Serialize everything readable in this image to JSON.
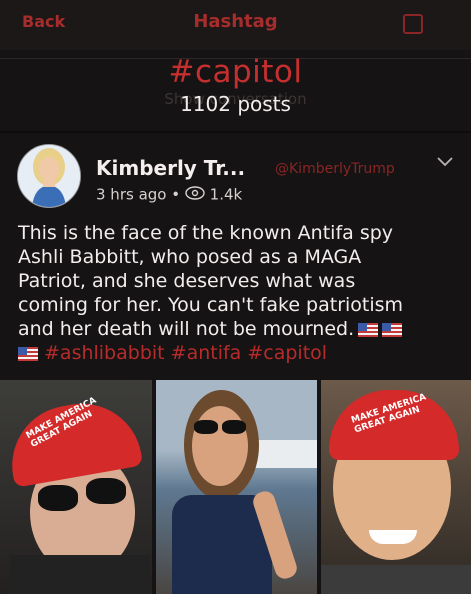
{
  "nav": {
    "back_label": "Back",
    "title": "Hashtag"
  },
  "header": {
    "hashtag": "#capitol",
    "faded_text": "Show conversation",
    "posts_count": "1102 posts"
  },
  "post": {
    "display_name": "Kimberly Tr...",
    "handle": "@KimberlyTrump",
    "time": "3 hrs ago",
    "dot": "•",
    "views": "1.4k",
    "lines": [
      "This is the face of the known Antifa spy",
      "Ashli Babbitt, who posed as a MAGA",
      "Patriot, and she deserves what was",
      "coming for her. You can't fake patriotism",
      "and her death will not be mourned."
    ],
    "hashtags": "#ashlibabbit #antifa #capitol"
  },
  "photos": {
    "hat_text_1": "MAKE AMERICA GREAT AGAIN",
    "hat_text_3": "MAKE AMERICA GREAT AGAIN"
  },
  "colors": {
    "accent": "#c62f2f",
    "background": "#151313"
  },
  "icons": [
    "chevron-down-icon",
    "eye-icon",
    "us-flag-icon",
    "square-icon"
  ]
}
